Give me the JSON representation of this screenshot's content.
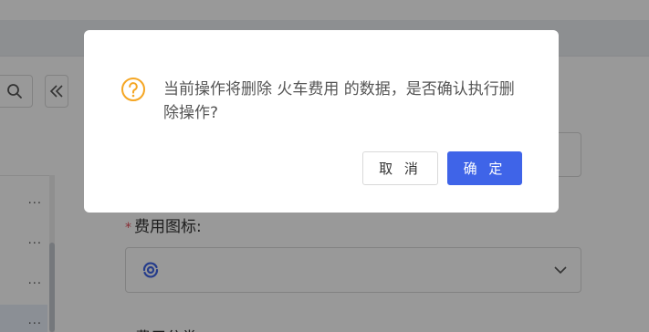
{
  "dialog": {
    "message": "当前操作将删除 火车费用 的数据，是否确认执行删除操作?",
    "cancel_label": "取 消",
    "confirm_label": "确 定",
    "icon": "question-circle-icon",
    "icon_color": "#f5a623",
    "confirm_color": "#3f64e8"
  },
  "form": {
    "required_mark": "*",
    "icon_field_label": "费用图标:",
    "icon_field_value_icon": "eye-swirl-icon",
    "next_field_label_partial": "费用分类"
  },
  "sidebar": {
    "row_menu_glyph": "···"
  },
  "colors": {
    "required": "#e34d59",
    "accent": "#3f64e8"
  }
}
